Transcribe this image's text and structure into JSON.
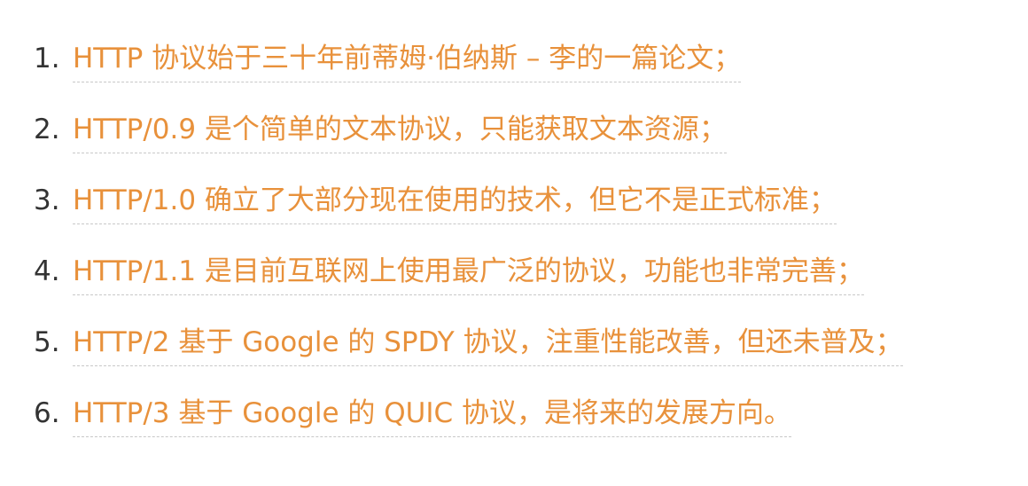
{
  "colors": {
    "link": "#e8913b",
    "number": "#333333",
    "underline": "#c8c8c8",
    "background": "#ffffff"
  },
  "items": [
    {
      "number": "1.",
      "text": "HTTP 协议始于三十年前蒂姆·伯纳斯 – 李的一篇论文；"
    },
    {
      "number": "2.",
      "text": "HTTP/0.9 是个简单的文本协议，只能获取文本资源；"
    },
    {
      "number": "3.",
      "text": "HTTP/1.0 确立了大部分现在使用的技术，但它不是正式标准；"
    },
    {
      "number": "4.",
      "text": "HTTP/1.1 是目前互联网上使用最广泛的协议，功能也非常完善；"
    },
    {
      "number": "5.",
      "text": "HTTP/2 基于 Google 的 SPDY 协议，注重性能改善，但还未普及；"
    },
    {
      "number": "6.",
      "text": "HTTP/3 基于 Google 的 QUIC 协议，是将来的发展方向。"
    }
  ]
}
